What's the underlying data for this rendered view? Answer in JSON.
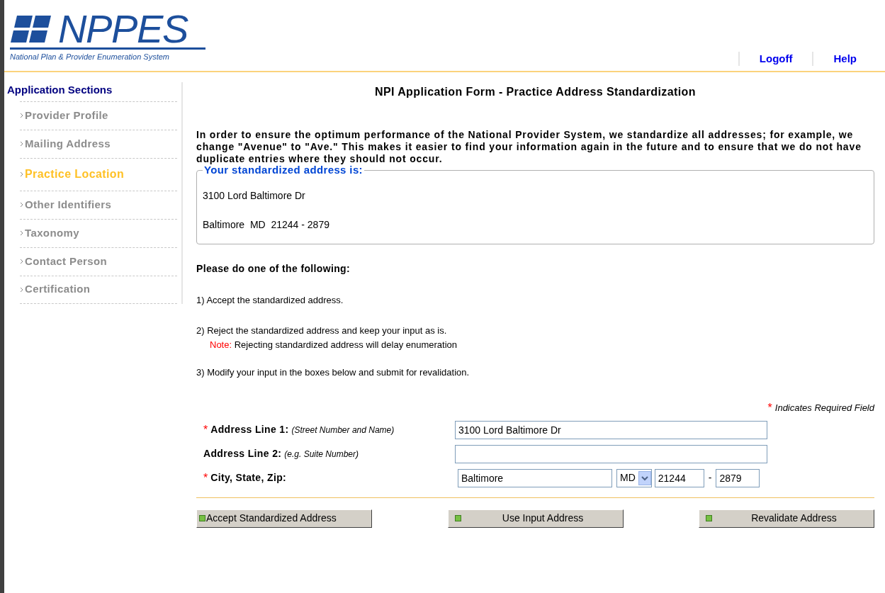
{
  "header": {
    "logo_text": "NPPES",
    "logo_subtitle": "National Plan & Provider Enumeration System",
    "links": [
      "Logoff",
      "Help"
    ]
  },
  "sidebar": {
    "title": "Application Sections",
    "items": [
      {
        "label": "Provider Profile",
        "selected": false
      },
      {
        "label": "Mailing Address",
        "selected": false
      },
      {
        "label": "Practice Location",
        "selected": true
      },
      {
        "label": "Other Identifiers",
        "selected": false
      },
      {
        "label": "Taxonomy",
        "selected": false
      },
      {
        "label": "Contact Person",
        "selected": false
      },
      {
        "label": "Certification",
        "selected": false
      }
    ]
  },
  "page_title": "NPI Application Form - Practice Address Standardization",
  "intro": "In order to ensure the optimum performance of the National Provider System, we standardize all addresses; for example, we change \"Avenue\" to \"Ave.\" This makes it easier to find your information again in the future and to ensure that we do not have duplicate entries where they should not occur.",
  "standardized": {
    "legend": "Your standardized address is:",
    "lines": [
      "3100 Lord Baltimore Dr",
      "Baltimore  MD  21244 - 2879"
    ]
  },
  "instructions": {
    "heading": "Please do one of the following:",
    "options": [
      {
        "text": "1) Accept the standardized address."
      },
      {
        "text": "2) Reject the standardized address and keep your input as is.",
        "note_label": "Note:",
        "note": "Rejecting standardized address will delay enumeration"
      },
      {
        "text": "3) Modify your input in the boxes below and submit for revalidation."
      }
    ]
  },
  "required_legend": {
    "mark": "*",
    "text": "Indicates Required Field"
  },
  "form": {
    "address1": {
      "required": true,
      "label": "Address Line 1:",
      "hint": "(Street Number and Name)",
      "value": "3100 Lord Baltimore Dr"
    },
    "address2": {
      "required": false,
      "label": "Address Line 2:",
      "hint": "(e.g. Suite Number)"
    },
    "city_row": {
      "required": true,
      "label": "City, State, Zip:",
      "city": "Baltimore",
      "state": "MD",
      "zip": "21244",
      "separator": "-",
      "zip4": "2879"
    }
  },
  "buttons": [
    "Accept Standardized Address",
    "Use Input Address",
    "Revalidate Address"
  ]
}
